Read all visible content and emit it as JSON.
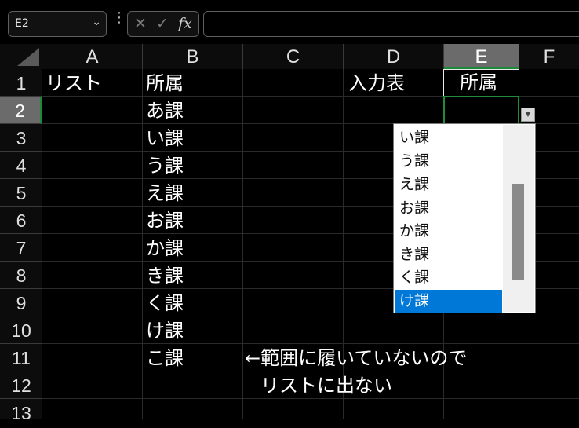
{
  "formula_bar": {
    "name_box": "E2",
    "cancel_icon": "✕",
    "enter_icon": "✓",
    "fx_label": "fx",
    "formula": ""
  },
  "columns": [
    "A",
    "B",
    "C",
    "D",
    "E",
    "F"
  ],
  "rows": [
    "1",
    "2",
    "3",
    "4",
    "5",
    "6",
    "7",
    "8",
    "9",
    "10",
    "11",
    "12",
    "13"
  ],
  "selected_column": "E",
  "selected_row": "2",
  "cells": {
    "A1": "リスト",
    "B1": "所属",
    "B2": "あ課",
    "B3": "い課",
    "B4": "う課",
    "B5": "え課",
    "B6": "お課",
    "B7": "か課",
    "B8": "き課",
    "B9": "く課",
    "B10": "け課",
    "B11": "こ課",
    "D1": "入力表",
    "E1": "所属",
    "E2": ""
  },
  "annotation": {
    "line1": "←範囲に履いていないので",
    "line2": "リストに出ない"
  },
  "dropdown": {
    "items": [
      "い課",
      "う課",
      "え課",
      "お課",
      "か課",
      "き課",
      "く課",
      "け課"
    ],
    "selected": "け課",
    "scroll_position": 0.6
  },
  "colors": {
    "background": "#000000",
    "header_selected": "#6b6b6b",
    "active_border": "#1f8c3c",
    "dropdown_highlight": "#0078d7"
  }
}
